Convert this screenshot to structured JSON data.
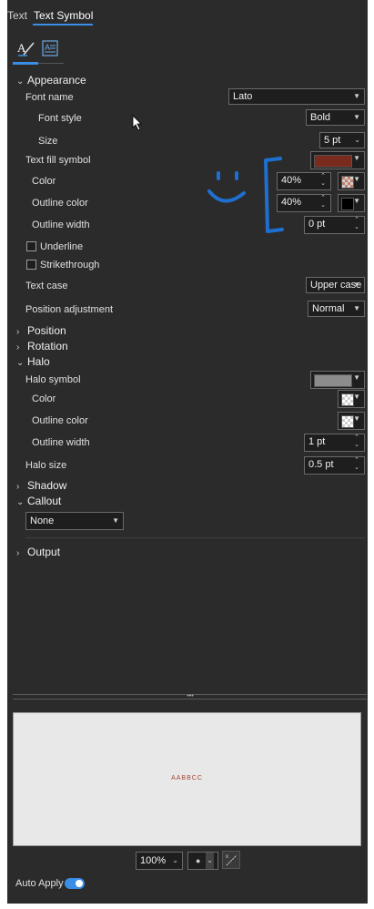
{
  "tabs": [
    "Text",
    "Text Symbol"
  ],
  "subtabs": {
    "active": "paintbrush-icon",
    "other": "text-properties-icon"
  },
  "appearance": {
    "header": "Appearance",
    "font_name_label": "Font name",
    "font_name": "Lato",
    "font_style_label": "Font style",
    "font_style": "Bold",
    "size_label": "Size",
    "size": "5 pt",
    "text_fill_label": "Text fill symbol",
    "fill_color_hex": "#7a2b1d",
    "color_label": "Color",
    "color_pct": "40%",
    "color_swatch_hex": "#c77d6b",
    "outline_color_label": "Outline color",
    "outline_pct": "40%",
    "outline_swatch_hex": "#000000",
    "outline_width_label": "Outline width",
    "outline_width": "0 pt",
    "underline_label": "Underline",
    "strikethrough_label": "Strikethrough",
    "text_case_label": "Text case",
    "text_case": "Upper case",
    "position_adj_label": "Position adjustment",
    "position_adj": "Normal"
  },
  "sections": {
    "position": "Position",
    "rotation": "Rotation",
    "halo": "Halo",
    "shadow": "Shadow",
    "callout": "Callout",
    "output": "Output"
  },
  "halo": {
    "halo_symbol_label": "Halo symbol",
    "halo_symbol_hex": "#8c8c8c",
    "color_label": "Color",
    "outline_color_label": "Outline color",
    "outline_width_label": "Outline width",
    "outline_width": "1 pt",
    "halo_size_label": "Halo size",
    "halo_size": "0.5 pt"
  },
  "callout": {
    "value": "None"
  },
  "preview": {
    "sample_text": "AABBCC",
    "sample_color": "#a0452f"
  },
  "footer": {
    "zoom": "100%",
    "auto_apply_label": "Auto Apply",
    "accent": "#3a8ee6"
  }
}
